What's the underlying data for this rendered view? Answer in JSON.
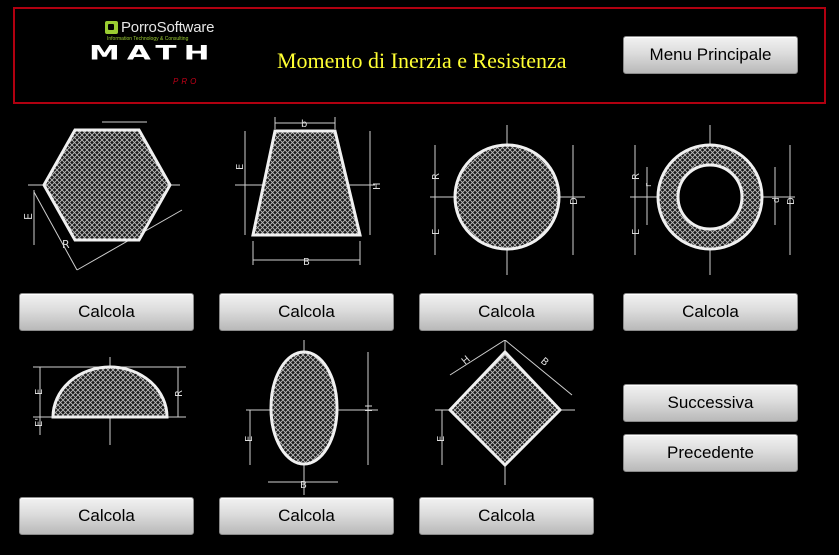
{
  "header": {
    "brand": "PorroSoftware",
    "brand_tagline": "Information Technology & Consulting",
    "product": "MATH",
    "product_edition": "PRO",
    "title": "Momento di Inerzia e Resistenza",
    "menu_button": "Menu Principale"
  },
  "shapes": [
    {
      "name": "hexagon",
      "dims": [
        "E",
        "R"
      ],
      "button": "Calcola"
    },
    {
      "name": "trapezoid",
      "dims": [
        "b",
        "E",
        "H",
        "B"
      ],
      "button": "Calcola"
    },
    {
      "name": "circle",
      "dims": [
        "R",
        "E",
        "D"
      ],
      "button": "Calcola"
    },
    {
      "name": "ring",
      "dims": [
        "R",
        "r",
        "E",
        "d",
        "D"
      ],
      "button": "Calcola"
    },
    {
      "name": "semicircle",
      "dims": [
        "E",
        "E'",
        "R"
      ],
      "button": "Calcola"
    },
    {
      "name": "ellipse",
      "dims": [
        "E",
        "H",
        "B"
      ],
      "button": "Calcola"
    },
    {
      "name": "rhombus",
      "dims": [
        "H",
        "B",
        "E"
      ],
      "button": "Calcola"
    }
  ],
  "nav": {
    "next": "Successiva",
    "previous": "Precedente"
  },
  "colors": {
    "title": "#ffff33",
    "header_border": "#b00010",
    "background": "#000000",
    "brand_accent": "#9acd32"
  }
}
